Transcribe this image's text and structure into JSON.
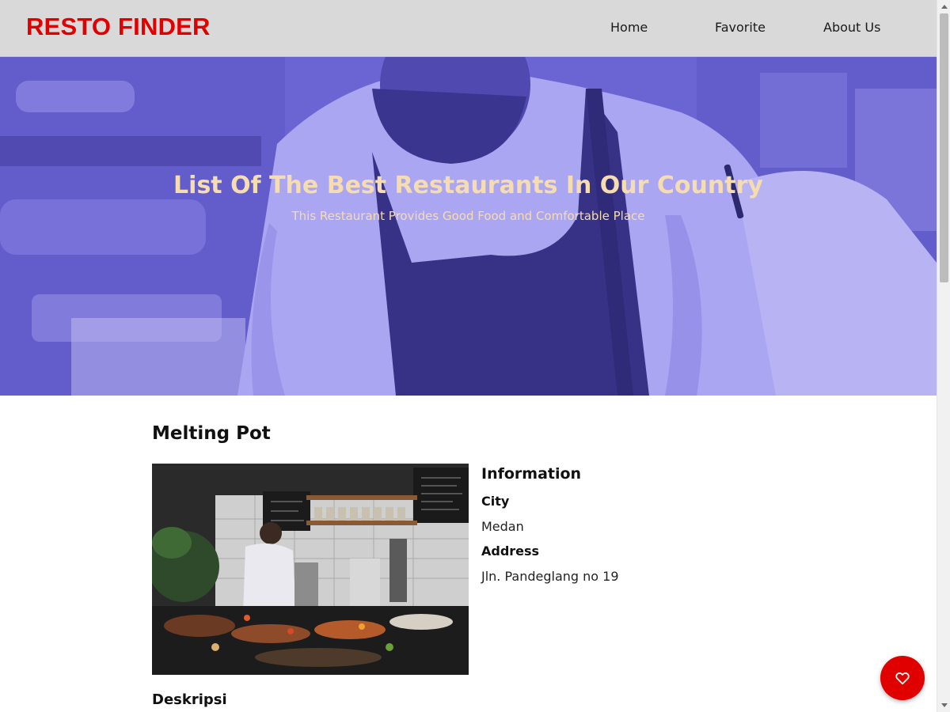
{
  "header": {
    "brand": "RESTO FINDER",
    "nav": [
      "Home",
      "Favorite",
      "About Us"
    ]
  },
  "hero": {
    "title": "List Of The Best Restaurants In Our Country",
    "subtitle": "This Restaurant Provides Good Food and Comfortable Place"
  },
  "restaurant": {
    "name": "Melting Pot",
    "info_heading": "Information",
    "city_label": "City",
    "city": "Medan",
    "address_label": "Address",
    "address": "Jln. Pandeglang no 19",
    "description_heading": "Deskripsi"
  },
  "favorite_button": {
    "icon": "heart-outline-icon"
  },
  "colors": {
    "brand": "#e00000",
    "navbar": "#d9d9d9",
    "hero_tint": "#6e67d6",
    "hero_text": "#f6dcb1"
  }
}
